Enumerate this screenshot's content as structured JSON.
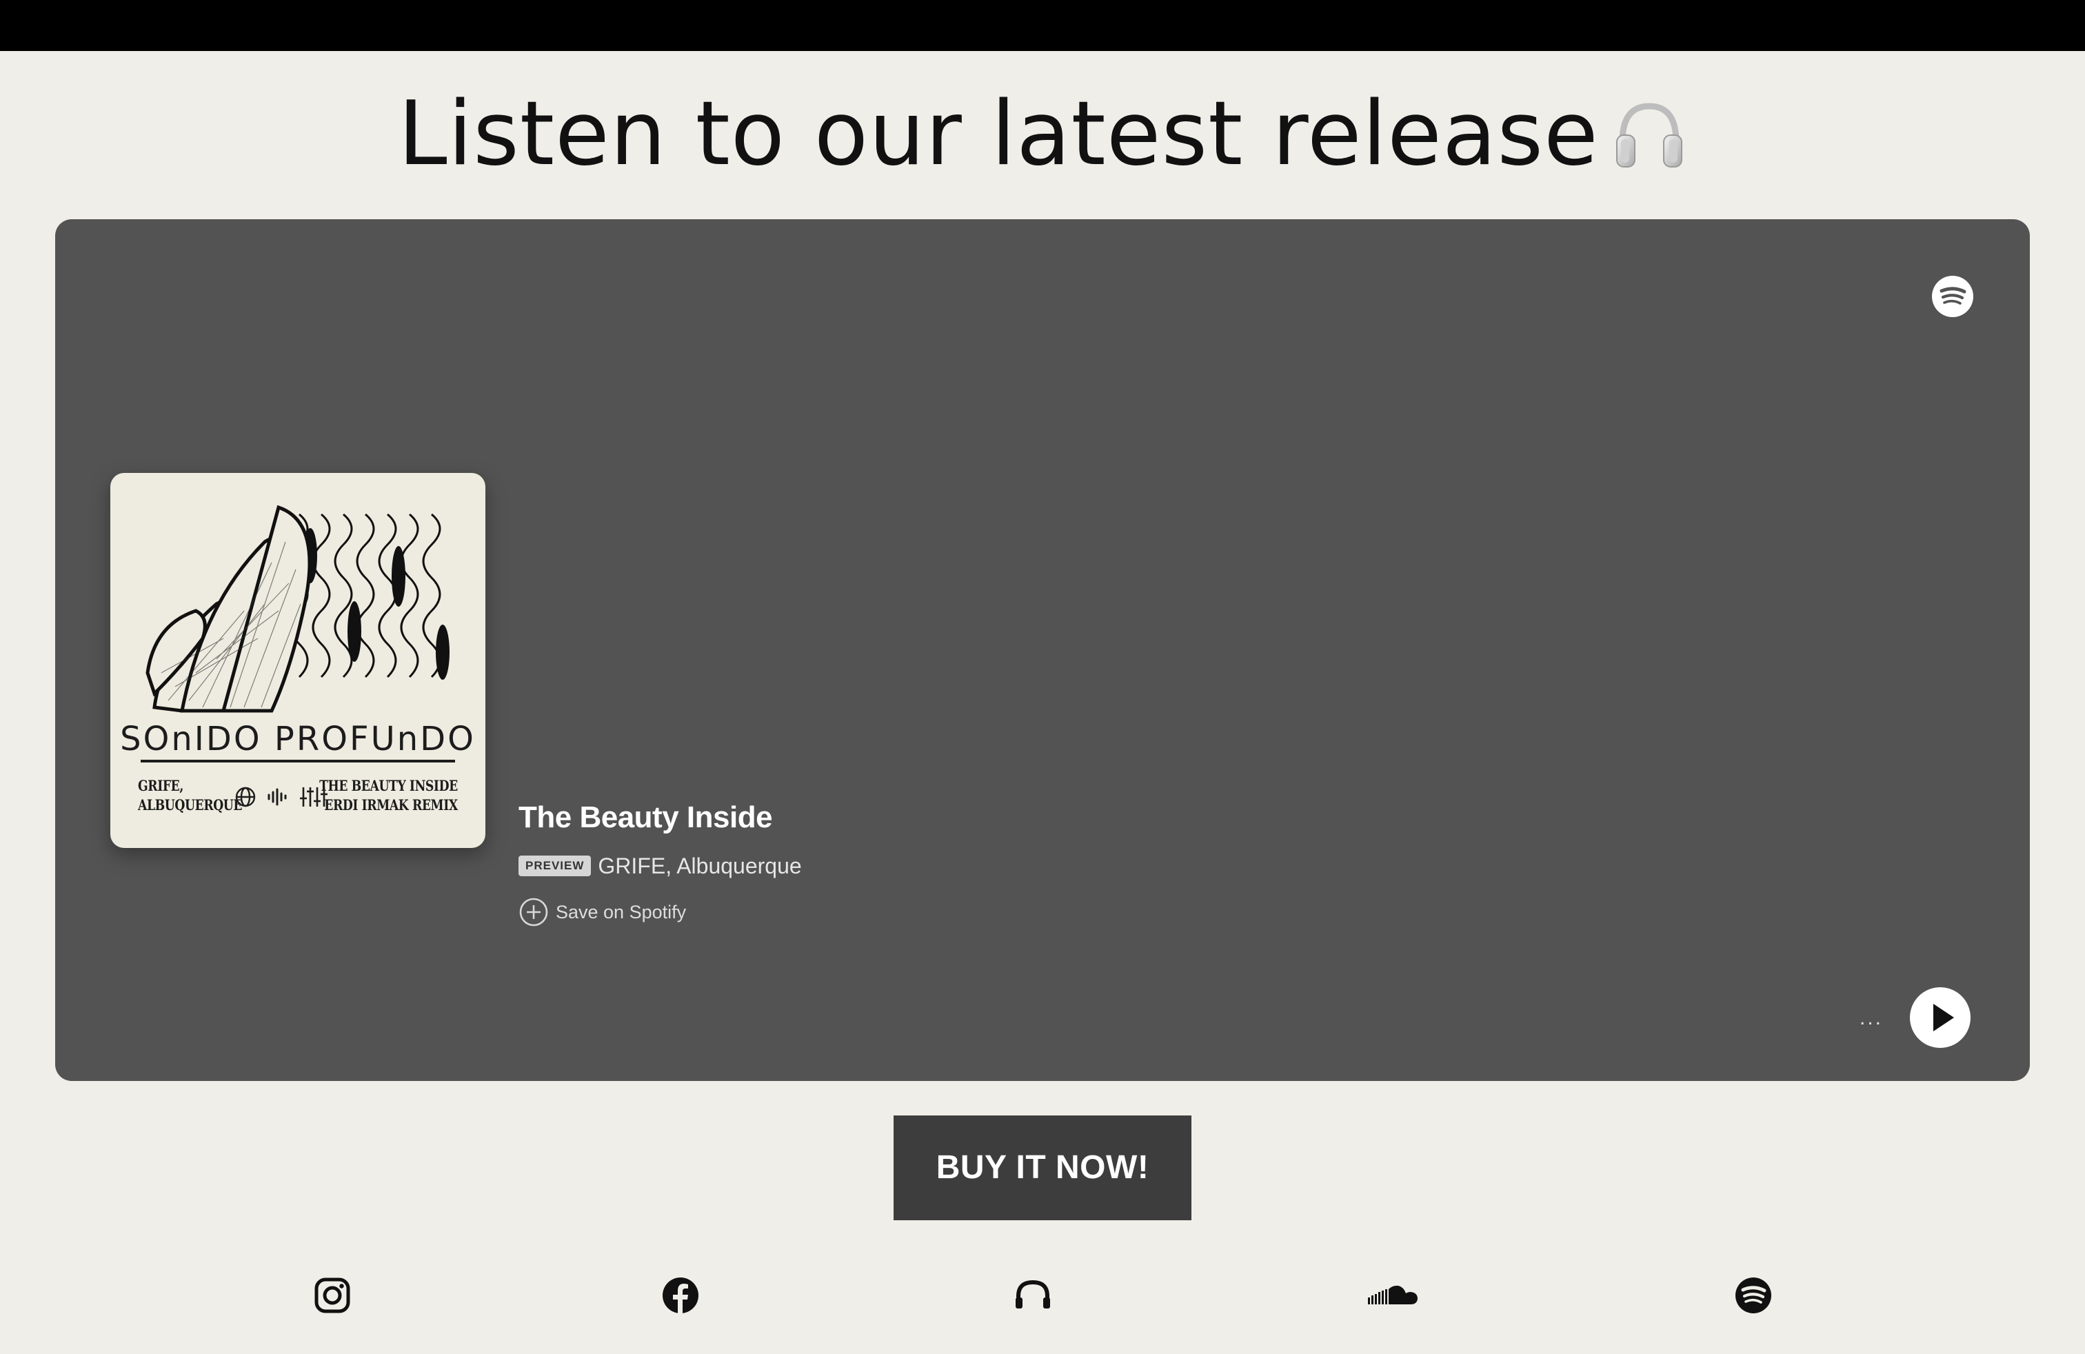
{
  "heading": {
    "title": "Listen to our latest release",
    "emoji": "🎧"
  },
  "player": {
    "track_title": "The Beauty Inside",
    "preview_badge": "PREVIEW",
    "artists": "GRIFE, Albuquerque",
    "save_label": "Save on Spotify",
    "more_label": "...",
    "icons": [
      "spotify-icon",
      "plus-circle-icon",
      "more-icon",
      "play-icon"
    ]
  },
  "cover": {
    "brand": "SOnIDO PROFUnDO",
    "left_lines": [
      "GRIFE,",
      "ALBUQUERQUE"
    ],
    "right_lines": [
      "THE BEAUTY INSIDE",
      "ERDI IRMAK REMIX"
    ]
  },
  "cta": {
    "buy_label": "BUY IT NOW!"
  },
  "social": {
    "icons": [
      "instagram-icon",
      "facebook-icon",
      "beatport-icon",
      "soundcloud-icon",
      "spotify-icon"
    ]
  },
  "colors": {
    "page_bg": "#efeee8",
    "embed_bg": "#535353",
    "button_bg": "#3d3d3d",
    "topbar": "#000000"
  }
}
